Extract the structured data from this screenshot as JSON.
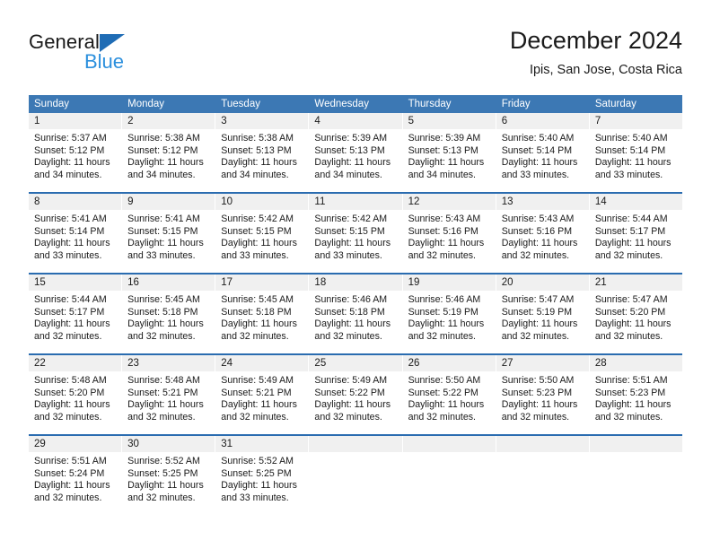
{
  "brand": {
    "name_part1": "General",
    "name_part2": "Blue",
    "triangle_icon": "triangle-icon",
    "accent_color": "#1f6cb5",
    "blue_text_color": "#2b8fdd"
  },
  "header": {
    "title": "December 2024",
    "subtitle": "Ipis, San Jose, Costa Rica"
  },
  "calendar": {
    "header_bg": "#3c78b4",
    "daynum_bg": "#f0f0f0",
    "row_divider_color": "#2a6cb0",
    "weekdays": [
      "Sunday",
      "Monday",
      "Tuesday",
      "Wednesday",
      "Thursday",
      "Friday",
      "Saturday"
    ],
    "weeks": [
      [
        {
          "day": "1",
          "sunrise": "Sunrise: 5:37 AM",
          "sunset": "Sunset: 5:12 PM",
          "daylight_line1": "Daylight: 11 hours",
          "daylight_line2": "and 34 minutes."
        },
        {
          "day": "2",
          "sunrise": "Sunrise: 5:38 AM",
          "sunset": "Sunset: 5:12 PM",
          "daylight_line1": "Daylight: 11 hours",
          "daylight_line2": "and 34 minutes."
        },
        {
          "day": "3",
          "sunrise": "Sunrise: 5:38 AM",
          "sunset": "Sunset: 5:13 PM",
          "daylight_line1": "Daylight: 11 hours",
          "daylight_line2": "and 34 minutes."
        },
        {
          "day": "4",
          "sunrise": "Sunrise: 5:39 AM",
          "sunset": "Sunset: 5:13 PM",
          "daylight_line1": "Daylight: 11 hours",
          "daylight_line2": "and 34 minutes."
        },
        {
          "day": "5",
          "sunrise": "Sunrise: 5:39 AM",
          "sunset": "Sunset: 5:13 PM",
          "daylight_line1": "Daylight: 11 hours",
          "daylight_line2": "and 34 minutes."
        },
        {
          "day": "6",
          "sunrise": "Sunrise: 5:40 AM",
          "sunset": "Sunset: 5:14 PM",
          "daylight_line1": "Daylight: 11 hours",
          "daylight_line2": "and 33 minutes."
        },
        {
          "day": "7",
          "sunrise": "Sunrise: 5:40 AM",
          "sunset": "Sunset: 5:14 PM",
          "daylight_line1": "Daylight: 11 hours",
          "daylight_line2": "and 33 minutes."
        }
      ],
      [
        {
          "day": "8",
          "sunrise": "Sunrise: 5:41 AM",
          "sunset": "Sunset: 5:14 PM",
          "daylight_line1": "Daylight: 11 hours",
          "daylight_line2": "and 33 minutes."
        },
        {
          "day": "9",
          "sunrise": "Sunrise: 5:41 AM",
          "sunset": "Sunset: 5:15 PM",
          "daylight_line1": "Daylight: 11 hours",
          "daylight_line2": "and 33 minutes."
        },
        {
          "day": "10",
          "sunrise": "Sunrise: 5:42 AM",
          "sunset": "Sunset: 5:15 PM",
          "daylight_line1": "Daylight: 11 hours",
          "daylight_line2": "and 33 minutes."
        },
        {
          "day": "11",
          "sunrise": "Sunrise: 5:42 AM",
          "sunset": "Sunset: 5:15 PM",
          "daylight_line1": "Daylight: 11 hours",
          "daylight_line2": "and 33 minutes."
        },
        {
          "day": "12",
          "sunrise": "Sunrise: 5:43 AM",
          "sunset": "Sunset: 5:16 PM",
          "daylight_line1": "Daylight: 11 hours",
          "daylight_line2": "and 32 minutes."
        },
        {
          "day": "13",
          "sunrise": "Sunrise: 5:43 AM",
          "sunset": "Sunset: 5:16 PM",
          "daylight_line1": "Daylight: 11 hours",
          "daylight_line2": "and 32 minutes."
        },
        {
          "day": "14",
          "sunrise": "Sunrise: 5:44 AM",
          "sunset": "Sunset: 5:17 PM",
          "daylight_line1": "Daylight: 11 hours",
          "daylight_line2": "and 32 minutes."
        }
      ],
      [
        {
          "day": "15",
          "sunrise": "Sunrise: 5:44 AM",
          "sunset": "Sunset: 5:17 PM",
          "daylight_line1": "Daylight: 11 hours",
          "daylight_line2": "and 32 minutes."
        },
        {
          "day": "16",
          "sunrise": "Sunrise: 5:45 AM",
          "sunset": "Sunset: 5:18 PM",
          "daylight_line1": "Daylight: 11 hours",
          "daylight_line2": "and 32 minutes."
        },
        {
          "day": "17",
          "sunrise": "Sunrise: 5:45 AM",
          "sunset": "Sunset: 5:18 PM",
          "daylight_line1": "Daylight: 11 hours",
          "daylight_line2": "and 32 minutes."
        },
        {
          "day": "18",
          "sunrise": "Sunrise: 5:46 AM",
          "sunset": "Sunset: 5:18 PM",
          "daylight_line1": "Daylight: 11 hours",
          "daylight_line2": "and 32 minutes."
        },
        {
          "day": "19",
          "sunrise": "Sunrise: 5:46 AM",
          "sunset": "Sunset: 5:19 PM",
          "daylight_line1": "Daylight: 11 hours",
          "daylight_line2": "and 32 minutes."
        },
        {
          "day": "20",
          "sunrise": "Sunrise: 5:47 AM",
          "sunset": "Sunset: 5:19 PM",
          "daylight_line1": "Daylight: 11 hours",
          "daylight_line2": "and 32 minutes."
        },
        {
          "day": "21",
          "sunrise": "Sunrise: 5:47 AM",
          "sunset": "Sunset: 5:20 PM",
          "daylight_line1": "Daylight: 11 hours",
          "daylight_line2": "and 32 minutes."
        }
      ],
      [
        {
          "day": "22",
          "sunrise": "Sunrise: 5:48 AM",
          "sunset": "Sunset: 5:20 PM",
          "daylight_line1": "Daylight: 11 hours",
          "daylight_line2": "and 32 minutes."
        },
        {
          "day": "23",
          "sunrise": "Sunrise: 5:48 AM",
          "sunset": "Sunset: 5:21 PM",
          "daylight_line1": "Daylight: 11 hours",
          "daylight_line2": "and 32 minutes."
        },
        {
          "day": "24",
          "sunrise": "Sunrise: 5:49 AM",
          "sunset": "Sunset: 5:21 PM",
          "daylight_line1": "Daylight: 11 hours",
          "daylight_line2": "and 32 minutes."
        },
        {
          "day": "25",
          "sunrise": "Sunrise: 5:49 AM",
          "sunset": "Sunset: 5:22 PM",
          "daylight_line1": "Daylight: 11 hours",
          "daylight_line2": "and 32 minutes."
        },
        {
          "day": "26",
          "sunrise": "Sunrise: 5:50 AM",
          "sunset": "Sunset: 5:22 PM",
          "daylight_line1": "Daylight: 11 hours",
          "daylight_line2": "and 32 minutes."
        },
        {
          "day": "27",
          "sunrise": "Sunrise: 5:50 AM",
          "sunset": "Sunset: 5:23 PM",
          "daylight_line1": "Daylight: 11 hours",
          "daylight_line2": "and 32 minutes."
        },
        {
          "day": "28",
          "sunrise": "Sunrise: 5:51 AM",
          "sunset": "Sunset: 5:23 PM",
          "daylight_line1": "Daylight: 11 hours",
          "daylight_line2": "and 32 minutes."
        }
      ],
      [
        {
          "day": "29",
          "sunrise": "Sunrise: 5:51 AM",
          "sunset": "Sunset: 5:24 PM",
          "daylight_line1": "Daylight: 11 hours",
          "daylight_line2": "and 32 minutes."
        },
        {
          "day": "30",
          "sunrise": "Sunrise: 5:52 AM",
          "sunset": "Sunset: 5:25 PM",
          "daylight_line1": "Daylight: 11 hours",
          "daylight_line2": "and 32 minutes."
        },
        {
          "day": "31",
          "sunrise": "Sunrise: 5:52 AM",
          "sunset": "Sunset: 5:25 PM",
          "daylight_line1": "Daylight: 11 hours",
          "daylight_line2": "and 33 minutes."
        },
        {
          "day": "",
          "sunrise": "",
          "sunset": "",
          "daylight_line1": "",
          "daylight_line2": ""
        },
        {
          "day": "",
          "sunrise": "",
          "sunset": "",
          "daylight_line1": "",
          "daylight_line2": ""
        },
        {
          "day": "",
          "sunrise": "",
          "sunset": "",
          "daylight_line1": "",
          "daylight_line2": ""
        },
        {
          "day": "",
          "sunrise": "",
          "sunset": "",
          "daylight_line1": "",
          "daylight_line2": ""
        }
      ]
    ]
  }
}
